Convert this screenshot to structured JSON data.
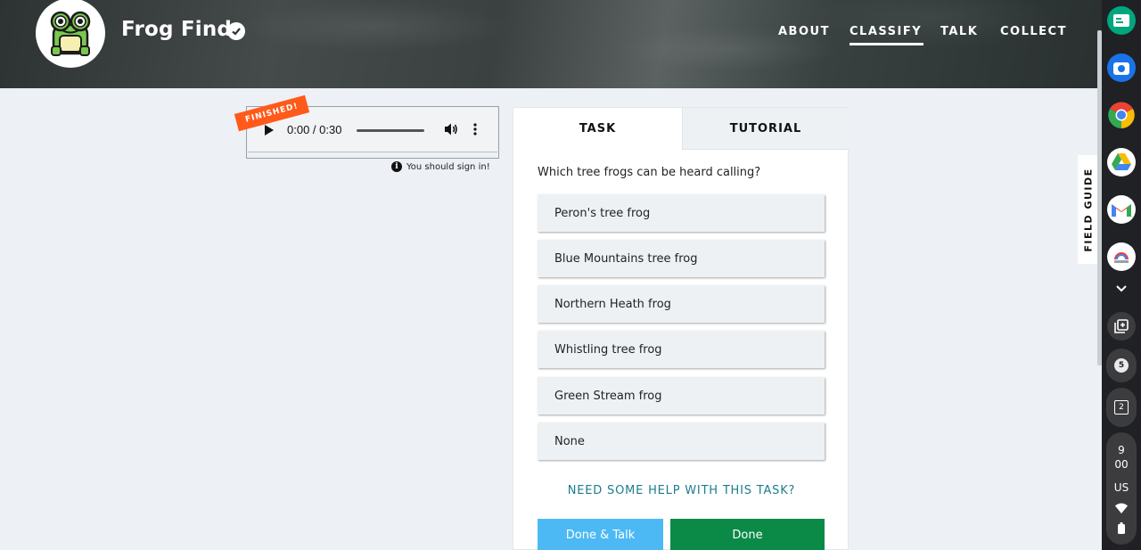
{
  "header": {
    "brand": "Frog Find",
    "nav": [
      {
        "label": "ABOUT"
      },
      {
        "label": "CLASSIFY",
        "active": true
      },
      {
        "label": "TALK"
      },
      {
        "label": "COLLECT"
      }
    ]
  },
  "audio": {
    "badge": "FINISHED!",
    "time": "0:00 / 0:30",
    "signin_note": "You should sign in!"
  },
  "task_panel": {
    "tabs": [
      "TASK",
      "TUTORIAL"
    ],
    "question": "Which tree frogs can be heard calling?",
    "options": [
      "Peron's tree frog",
      "Blue Mountains tree frog",
      "Northern Heath frog",
      "Whistling tree frog",
      "Green Stream frog",
      "None"
    ],
    "help_link": "NEED SOME HELP WITH THIS TASK?",
    "done_talk_label": "Done & Talk",
    "done_label": "Done"
  },
  "field_guide": {
    "label": "FIELD GUIDE"
  },
  "shelf": {
    "notification_count": "5",
    "desk_number": "2",
    "clock_hour": "9",
    "clock_minute": "00",
    "locale": "US"
  },
  "colors": {
    "accent_blue": "#4db9f4",
    "done_green": "#0b8a47",
    "finished_orange": "#ff5a1a",
    "help_teal": "#1d7d8c"
  }
}
